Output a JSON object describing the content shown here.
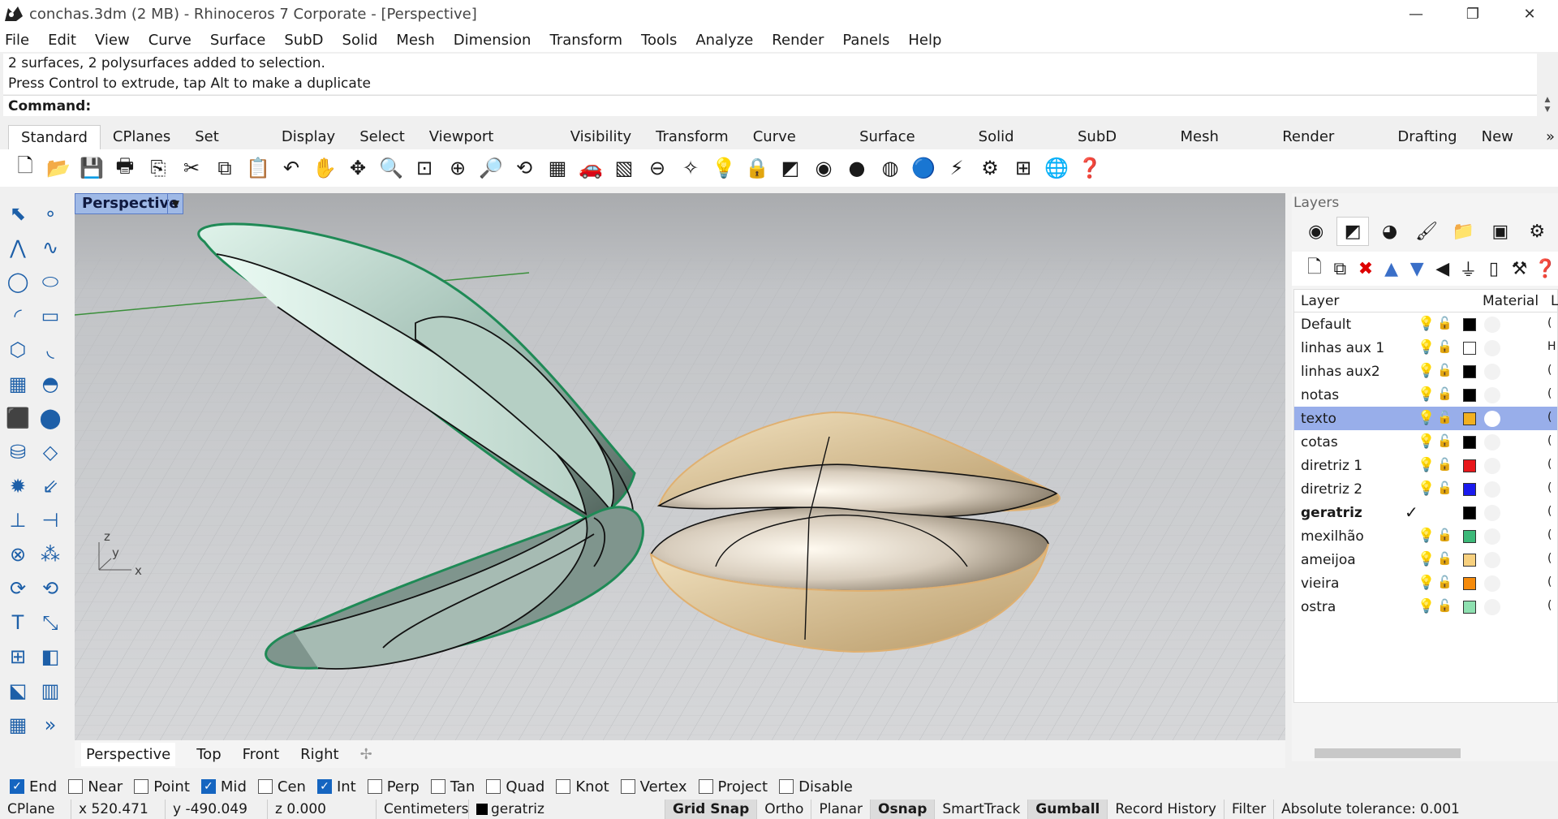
{
  "window": {
    "title": "conchas.3dm (2 MB) - Rhinoceros 7 Corporate - [Perspective]",
    "minimize": "—",
    "restore": "❐",
    "close": "✕"
  },
  "menu": [
    "File",
    "Edit",
    "View",
    "Curve",
    "Surface",
    "SubD",
    "Solid",
    "Mesh",
    "Dimension",
    "Transform",
    "Tools",
    "Analyze",
    "Render",
    "Panels",
    "Help"
  ],
  "command_history": [
    "2 surfaces, 2 polysurfaces added to selection.",
    "Press Control to extrude, tap Alt to make a duplicate"
  ],
  "command_prompt": "Command:",
  "toolbar_tabs": [
    "Standard",
    "CPlanes",
    "Set View",
    "Display",
    "Select",
    "Viewport Layout",
    "Visibility",
    "Transform",
    "Curve Tools",
    "Surface Tools",
    "Solid Tools",
    "SubD Tools",
    "Mesh Tools",
    "Render Tools",
    "Drafting",
    "New in"
  ],
  "toolbar_tabs_overflow": "»",
  "toolbar_icons": [
    "new-file-icon",
    "open-folder-icon",
    "save-icon",
    "print-icon",
    "import-icon",
    "cut-icon",
    "copy-icon",
    "paste-icon",
    "undo-icon",
    "pan-hand-icon",
    "rotate-view-icon",
    "zoom-icon",
    "zoom-window-icon",
    "zoom-extents-icon",
    "zoom-selected-icon",
    "rotate-camera-icon",
    "viewport-layout-icon",
    "car-icon",
    "grid-icon",
    "cplane-icon",
    "osnap-icon",
    "light-bulb-icon",
    "lock-icon",
    "layers-icon",
    "color-wheel-icon",
    "shaded-sphere-icon",
    "rendered-sphere-icon",
    "blue-sphere-icon",
    "flashlight-icon",
    "options-gear-icon",
    "dimension-icon",
    "globe-icon",
    "help-icon"
  ],
  "viewport": {
    "active_name": "Perspective",
    "tabs": [
      "Perspective",
      "Top",
      "Front",
      "Right"
    ],
    "axes": {
      "z": "z",
      "y": "y",
      "x": "x"
    }
  },
  "panel": {
    "title": "Layers",
    "tab_icons": [
      "color-wheel-icon",
      "layers-icon",
      "render-sphere-icon",
      "brush-icon",
      "folder-icon",
      "help-panel-icon",
      "settings-icon"
    ],
    "tool_icons": [
      "new-layer-icon",
      "new-sublayer-icon",
      "delete-icon",
      "move-up-icon",
      "move-down-icon",
      "move-left-icon",
      "filter-icon",
      "copy-doc-icon",
      "tools-icon",
      "help-icon"
    ],
    "columns": [
      "Layer",
      "Material",
      "L"
    ],
    "layers": [
      {
        "name": "Default",
        "color": "#000000",
        "current": false,
        "selected": false,
        "tail": "("
      },
      {
        "name": "linhas aux 1",
        "color": "#ffffff",
        "current": false,
        "selected": false,
        "tail": "H"
      },
      {
        "name": "linhas aux2",
        "color": "#000000",
        "current": false,
        "selected": false,
        "tail": "("
      },
      {
        "name": "notas",
        "color": "#000000",
        "current": false,
        "selected": false,
        "tail": "("
      },
      {
        "name": "texto",
        "color": "#f2b01f",
        "current": false,
        "selected": true,
        "tail": "("
      },
      {
        "name": "cotas",
        "color": "#000000",
        "current": false,
        "selected": false,
        "tail": "("
      },
      {
        "name": "diretriz 1",
        "color": "#e8161a",
        "current": false,
        "selected": false,
        "tail": "("
      },
      {
        "name": "diretriz 2",
        "color": "#1a1aee",
        "current": false,
        "selected": false,
        "tail": "("
      },
      {
        "name": "geratriz",
        "color": "#000000",
        "current": true,
        "selected": false,
        "tail": "("
      },
      {
        "name": "mexilhão",
        "color": "#3cb878",
        "current": false,
        "selected": false,
        "tail": "("
      },
      {
        "name": "ameijoa",
        "color": "#f7d07e",
        "current": false,
        "selected": false,
        "tail": "("
      },
      {
        "name": "vieira",
        "color": "#f58a0a",
        "current": false,
        "selected": false,
        "tail": "("
      },
      {
        "name": "ostra",
        "color": "#8ee0b0",
        "current": false,
        "selected": false,
        "tail": "("
      }
    ]
  },
  "osnaps": [
    {
      "label": "End",
      "checked": true
    },
    {
      "label": "Near",
      "checked": false
    },
    {
      "label": "Point",
      "checked": false
    },
    {
      "label": "Mid",
      "checked": true
    },
    {
      "label": "Cen",
      "checked": false
    },
    {
      "label": "Int",
      "checked": true
    },
    {
      "label": "Perp",
      "checked": false
    },
    {
      "label": "Tan",
      "checked": false
    },
    {
      "label": "Quad",
      "checked": false
    },
    {
      "label": "Knot",
      "checked": false
    },
    {
      "label": "Vertex",
      "checked": false
    },
    {
      "label": "Project",
      "checked": false
    },
    {
      "label": "Disable",
      "checked": false
    }
  ],
  "status": {
    "cplane": "CPlane",
    "x": "x 520.471",
    "y": "y -490.049",
    "z": "z 0.000",
    "units": "Centimeters",
    "layer": "geratriz",
    "grid_snap": "Grid Snap",
    "ortho": "Ortho",
    "planar": "Planar",
    "osnap": "Osnap",
    "smarttrack": "SmartTrack",
    "gumball": "Gumball",
    "record_history": "Record History",
    "filter": "Filter",
    "tolerance": "Absolute tolerance: 0.001"
  },
  "colors": {
    "accent": "#98aeea",
    "viewport_bg": "#c9cbcf",
    "shell_green": "#c9e8dc",
    "shell_beige": "#e2c99b"
  }
}
